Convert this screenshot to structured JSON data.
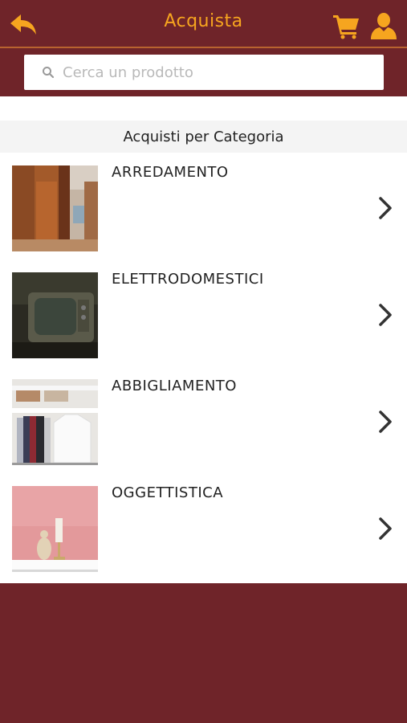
{
  "header": {
    "title": "Acquista",
    "back_icon": "back-arrow-icon",
    "cart_icon": "cart-icon",
    "user_icon": "user-icon",
    "accent_color": "#f6a51f",
    "background_color": "#6f2429"
  },
  "search": {
    "placeholder": "Cerca un prodotto",
    "value": "",
    "icon": "search-icon"
  },
  "section": {
    "title": "Acquisti per Categoria"
  },
  "categories": [
    {
      "label": "ARREDAMENTO",
      "image": "wardrobe-photo"
    },
    {
      "label": "ELETTRODOMESTICI",
      "image": "television-photo"
    },
    {
      "label": "ABBIGLIAMENTO",
      "image": "closet-clothes-photo"
    },
    {
      "label": "OGGETTISTICA",
      "image": "decor-objects-photo"
    }
  ]
}
